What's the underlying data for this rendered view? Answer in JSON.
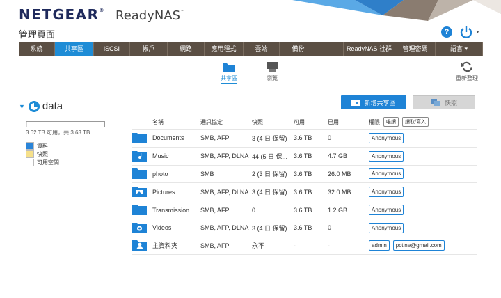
{
  "header": {
    "brand": "NETGEAR",
    "brand_mark": "®",
    "product": "ReadyNAS",
    "product_mark": "™",
    "page_title": "管理頁面"
  },
  "nav": [
    {
      "label": "系統",
      "width": 52,
      "active": false
    },
    {
      "label": "共享區",
      "width": 56,
      "active": true
    },
    {
      "label": "iSCSI",
      "width": 52,
      "active": false
    },
    {
      "label": "帳戶",
      "width": 54,
      "active": false
    },
    {
      "label": "網路",
      "width": 53,
      "active": false
    },
    {
      "label": "應用程式",
      "width": 56,
      "active": false
    },
    {
      "label": "雲端",
      "width": 52,
      "active": false
    },
    {
      "label": "備份",
      "width": 54,
      "active": false
    },
    {
      "label": "",
      "width": 38,
      "active": false
    },
    {
      "label": "ReadyNAS 社群",
      "width": 74,
      "active": false
    },
    {
      "label": "管理密碼",
      "width": 58,
      "active": false
    },
    {
      "label": "語言 ▾",
      "width": 68,
      "active": false
    }
  ],
  "subtabs": {
    "shares": "共享區",
    "browse": "瀏覽",
    "refresh": "重新整理"
  },
  "volume": {
    "name": "data",
    "capacity_text": "3.62 TB 可用，共 3.63 TB",
    "used_fraction": 0.003,
    "legend": [
      {
        "label": "資料",
        "color": "#2a84d8"
      },
      {
        "label": "快照",
        "color": "#f6e08a"
      },
      {
        "label": "可用空間",
        "color": "#ffffff"
      }
    ]
  },
  "actions": {
    "new_share": "新增共享區",
    "snapshot": "快照"
  },
  "table": {
    "headers": {
      "name": "名稱",
      "protocol": "通訊協定",
      "snapshot": "快照",
      "available": "可用",
      "used": "已用",
      "permission": "權限",
      "perm_ro": "唯讀",
      "perm_rw": "讀取/寫入"
    },
    "rows": [
      {
        "name": "Documents",
        "protocol": "SMB, AFP",
        "snapshot": "3 (4 日 保留)",
        "available": "3.6 TB",
        "used": "0",
        "perms": [
          "Anonymous"
        ],
        "icon": "folder-icon"
      },
      {
        "name": "Music",
        "protocol": "SMB, AFP, DLNA",
        "snapshot": "44 (5 日 保...",
        "available": "3.6 TB",
        "used": "4.7 GB",
        "perms": [
          "Anonymous"
        ],
        "icon": "music-folder-icon"
      },
      {
        "name": "photo",
        "protocol": "SMB",
        "snapshot": "2 (3 日 保留)",
        "available": "3.6 TB",
        "used": "26.0 MB",
        "perms": [
          "Anonymous"
        ],
        "icon": "folder-icon"
      },
      {
        "name": "Pictures",
        "protocol": "SMB, AFP, DLNA",
        "snapshot": "3 (4 日 保留)",
        "available": "3.6 TB",
        "used": "32.0 MB",
        "perms": [
          "Anonymous"
        ],
        "icon": "pictures-folder-icon"
      },
      {
        "name": "Transmission",
        "protocol": "SMB, AFP",
        "snapshot": "0",
        "available": "3.6 TB",
        "used": "1.2 GB",
        "perms": [
          "Anonymous"
        ],
        "icon": "folder-icon"
      },
      {
        "name": "Videos",
        "protocol": "SMB, AFP, DLNA",
        "snapshot": "3 (4 日 保留)",
        "available": "3.6 TB",
        "used": "0",
        "perms": [
          "Anonymous"
        ],
        "icon": "video-folder-icon"
      },
      {
        "name": "主資料夾",
        "protocol": "SMB, AFP",
        "snapshot": "永不",
        "available": "-",
        "used": "-",
        "perms": [
          "admin",
          "pctine@gmail.com"
        ],
        "icon": "home-folder-icon"
      }
    ]
  },
  "colors": {
    "accent": "#1e83d6",
    "navbar": "#5b4f44",
    "brand": "#1f2a5c"
  }
}
